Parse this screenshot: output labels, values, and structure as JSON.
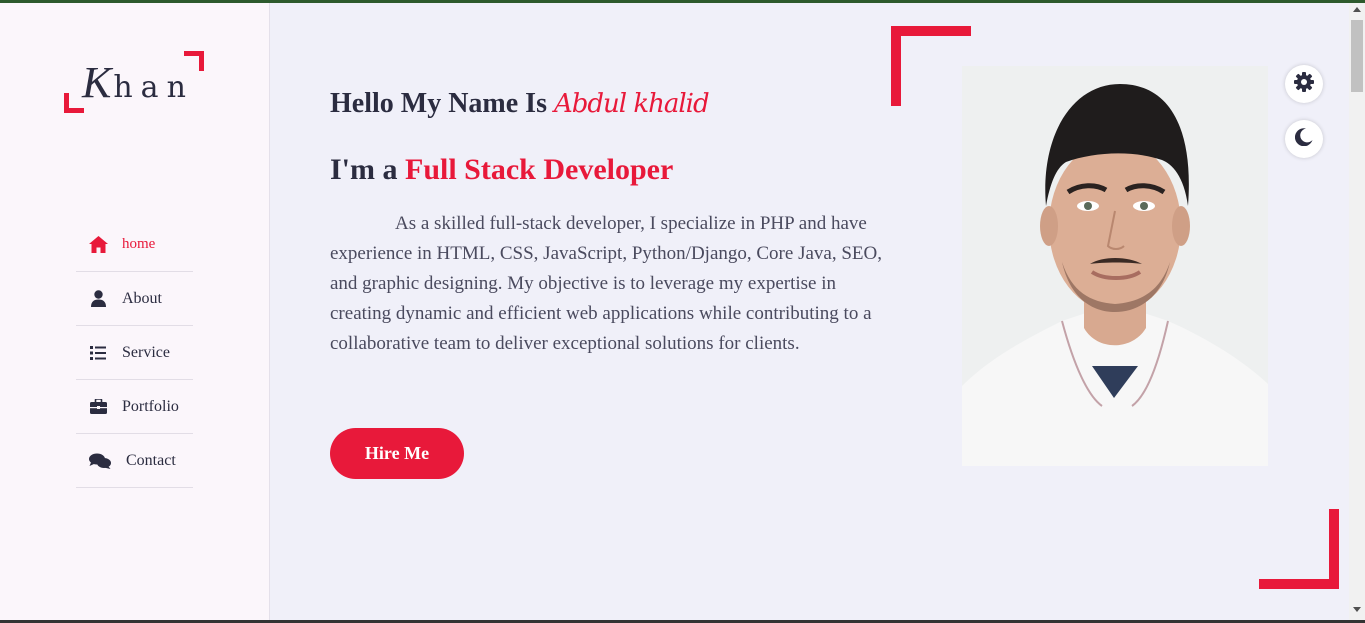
{
  "logo": {
    "first_letter": "K",
    "rest": "han"
  },
  "nav": {
    "items": [
      {
        "label": "home",
        "icon": "home-icon",
        "active": true
      },
      {
        "label": "About",
        "icon": "user-icon",
        "active": false
      },
      {
        "label": "Service",
        "icon": "list-icon",
        "active": false
      },
      {
        "label": "Portfolio",
        "icon": "briefcase-icon",
        "active": false
      },
      {
        "label": "Contact",
        "icon": "comments-icon",
        "active": false
      }
    ]
  },
  "hero": {
    "greeting": "Hello My Name Is",
    "name": "Abdul khalid",
    "role_prefix": "I'm a",
    "role": "Full Stack Developer",
    "description": "As a skilled full-stack developer, I specialize in PHP and have experience in HTML, CSS, JavaScript, Python/Django, Core Java, SEO, and graphic designing. My objective is to leverage my expertise in creating dynamic and efficient web applications while contributing to a collaborative team to deliver exceptional solutions for clients.",
    "cta_label": "Hire Me"
  },
  "controls": {
    "settings_icon": "gear-icon",
    "theme_icon": "moon-icon"
  },
  "colors": {
    "accent": "#e8193a",
    "text": "#2b2c40",
    "background": "#f0f0f9",
    "sidebar": "#fbf6fb"
  }
}
